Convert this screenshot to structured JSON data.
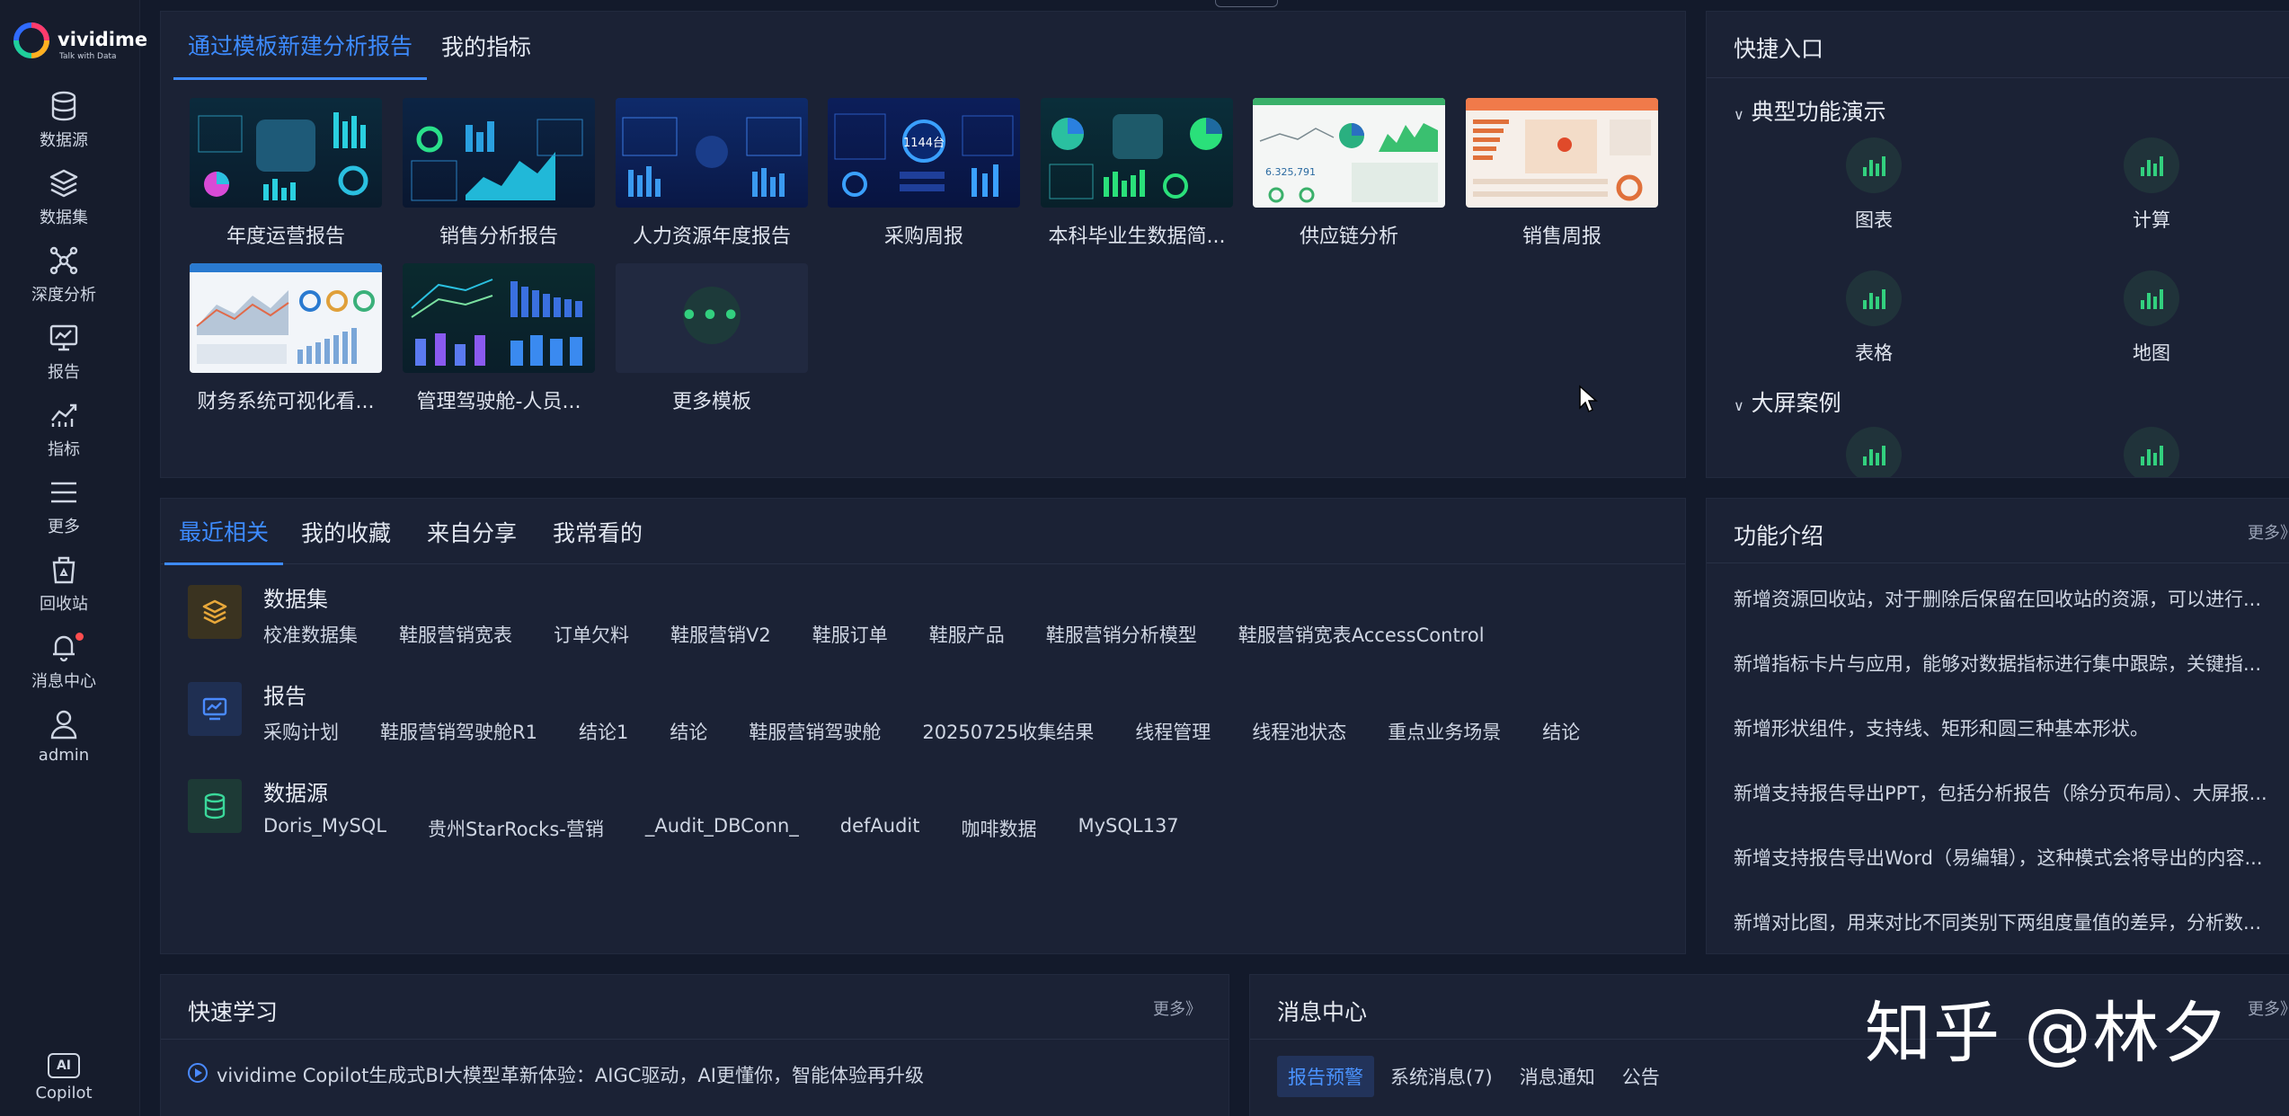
{
  "brand": {
    "name": "vividime",
    "tagline": "Talk with Data"
  },
  "sidebar": {
    "items": [
      {
        "label": "数据源",
        "icon": "database-icon"
      },
      {
        "label": "数据集",
        "icon": "layers-icon"
      },
      {
        "label": "深度分析",
        "icon": "graph-nodes-icon"
      },
      {
        "label": "报告",
        "icon": "monitor-chart-icon"
      },
      {
        "label": "指标",
        "icon": "line-chart-icon"
      },
      {
        "label": "更多",
        "icon": "menu-icon"
      },
      {
        "label": "回收站",
        "icon": "recycle-bin-icon"
      },
      {
        "label": "消息中心",
        "icon": "bell-icon"
      },
      {
        "label": "admin",
        "icon": "user-icon"
      }
    ],
    "copilot": {
      "label": "Copilot",
      "icon_text": "AI"
    }
  },
  "templates_panel": {
    "tabs": [
      "通过模板新建分析报告",
      "我的指标"
    ],
    "templates": [
      {
        "label": "年度运营报告"
      },
      {
        "label": "销售分析报告"
      },
      {
        "label": "人力资源年度报告"
      },
      {
        "label": "采购周报",
        "badge": "1144台"
      },
      {
        "label": "本科毕业生数据简..."
      },
      {
        "label": "供应链分析",
        "kpi": "6.325,791"
      },
      {
        "label": "销售周报"
      },
      {
        "label": "财务系统可视化看..."
      },
      {
        "label": "管理驾驶舱-人员..."
      }
    ],
    "more_templates": {
      "label": "更多模板",
      "icon_text": "•••"
    }
  },
  "quick_entry": {
    "title": "快捷入口",
    "sections": [
      {
        "label": "典型功能演示",
        "items": [
          "图表",
          "计算",
          "表格",
          "地图"
        ]
      },
      {
        "label": "大屏案例",
        "items": [
          "",
          ""
        ]
      }
    ]
  },
  "recent_panel": {
    "tabs": [
      "最近相关",
      "我的收藏",
      "来自分享",
      "我常看的"
    ],
    "groups": [
      {
        "title": "数据集",
        "icon": "dataset-layers-icon",
        "items": [
          "校准数据集",
          "鞋服营销宽表",
          "订单欠料",
          "鞋服营销V2",
          "鞋服订单",
          "鞋服产品",
          "鞋服营销分析模型",
          "鞋服营销宽表AccessControl"
        ]
      },
      {
        "title": "报告",
        "icon": "report-monitor-icon",
        "items": [
          "采购计划",
          "鞋服营销驾驶舱R1",
          "结论1",
          "结论",
          "鞋服营销驾驶舱",
          "20250725收集结果",
          "线程管理",
          "线程池状态",
          "重点业务场景",
          "结论"
        ]
      },
      {
        "title": "数据源",
        "icon": "datasource-db-icon",
        "items": [
          "Doris_MySQL",
          "贵州StarRocks-营销",
          "_Audit_DBConn_",
          "defAudit",
          "咖啡数据",
          "MySQL137"
        ]
      }
    ]
  },
  "features_panel": {
    "title": "功能介绍",
    "more": "更多》",
    "items": [
      "新增资源回收站，对于删除后保留在回收站的资源，可以进行...",
      "新增指标卡片与应用，能够对数据指标进行集中跟踪，关键指...",
      "新增形状组件，支持线、矩形和圆三种基本形状。",
      "新增支持报告导出PPT，包括分析报告（除分页布局）、大屏报...",
      "新增支持报告导出Word（易编辑），这种模式会将导出的内容...",
      "新增对比图，用来对比不同类别下两组度量值的差异，分析数..."
    ]
  },
  "learn_panel": {
    "title": "快速学习",
    "more": "更多》",
    "items": [
      "vividime Copilot生成式BI大模型革新体验：AIGC驱动，AI更懂你，智能体验再升级"
    ]
  },
  "message_panel": {
    "title": "消息中心",
    "more": "更多》",
    "tabs": [
      "报告预警",
      "系统消息(7)",
      "消息通知",
      "公告"
    ]
  },
  "watermark": "知乎 @林夕",
  "colors": {
    "accent": "#3d8bff",
    "bg": "#131a2b",
    "panel": "#1b2235",
    "green": "#32d07e"
  }
}
